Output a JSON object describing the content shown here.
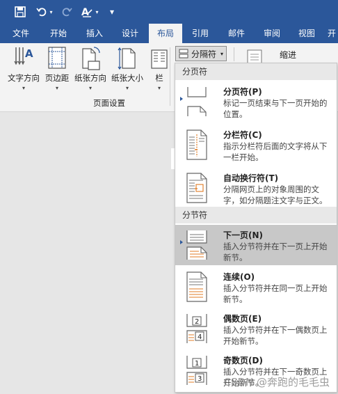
{
  "qat": {
    "customize": "▾"
  },
  "tabs": [
    "文件",
    "开始",
    "插入",
    "设计",
    "布局",
    "引用",
    "邮件",
    "审阅",
    "视图",
    "开"
  ],
  "active_tab": "布局",
  "ribbon": {
    "buttons": [
      "文字方向",
      "页边距",
      "纸张方向",
      "纸张大小",
      "栏"
    ],
    "group_label": "页面设置",
    "breaks_label": "分隔符",
    "indent_label": "缩进"
  },
  "dropdown": {
    "sections": [
      {
        "header": "分页符",
        "items": [
          {
            "title": "分页符(P)",
            "desc": "标记一页结束与下一页开始的位置。",
            "icon": "page-break-icon"
          },
          {
            "title": "分栏符(C)",
            "desc": "指示分栏符后面的文字将从下一栏开始。",
            "icon": "column-break-icon"
          },
          {
            "title": "自动换行符(T)",
            "desc": "分隔网页上的对象周围的文字，如分隔题注文字与正文。",
            "icon": "text-wrapping-icon"
          }
        ]
      },
      {
        "header": "分节符",
        "items": [
          {
            "title": "下一页(N)",
            "desc": "插入分节符并在下一页上开始新节。",
            "icon": "next-page-icon",
            "selected": true
          },
          {
            "title": "连续(O)",
            "desc": "插入分节符并在同一页上开始新节。",
            "icon": "continuous-icon"
          },
          {
            "title": "偶数页(E)",
            "desc": "插入分节符并在下一偶数页上开始新节。",
            "icon": "even-page-icon"
          },
          {
            "title": "奇数页(D)",
            "desc": "插入分节符并在下一奇数页上开始新节。",
            "icon": "odd-page-icon"
          }
        ]
      }
    ]
  },
  "watermark": "CSDN @奔跑的毛毛虫",
  "colors": {
    "accent": "#2b579a",
    "orange": "#e07b24"
  }
}
